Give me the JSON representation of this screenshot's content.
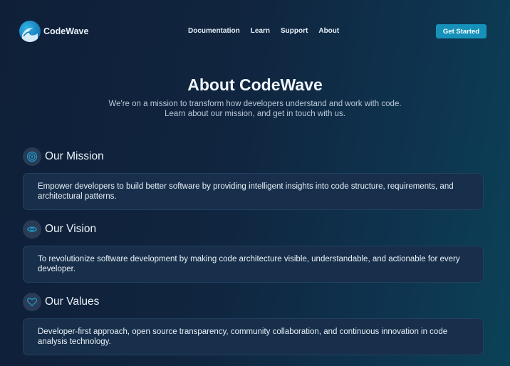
{
  "brand": {
    "name": "CodeWave",
    "icon": "wave-logo-icon"
  },
  "nav": {
    "items": [
      "Documentation",
      "Learn",
      "Support",
      "About"
    ],
    "cta_label": "Get Started"
  },
  "hero": {
    "title": "About CodeWave",
    "subtitle_line1": "We're on a mission to transform how developers understand and work with code.",
    "subtitle_line2": "Learn about our mission, and get in touch with us."
  },
  "sections": [
    {
      "icon": "target-icon",
      "title": "Our Mission",
      "body": "Empower developers to build better software by providing intelligent  insights into code structure, requirements, and architectural patterns."
    },
    {
      "icon": "eye-icon",
      "title": "Our Vision",
      "body": "To revolutionize software development by making code architecture visible, understandable, and actionable for every developer."
    },
    {
      "icon": "heart-icon",
      "title": "Our Values",
      "body": "Developer-first approach, open source transparency, community  collaboration, and continuous innovation in code analysis technology."
    }
  ],
  "colors": {
    "accent": "#1692ba",
    "background_start": "#0f1f38",
    "background_end": "#0b4257",
    "card": "#172f4b",
    "icon": "#1f9ccc"
  }
}
